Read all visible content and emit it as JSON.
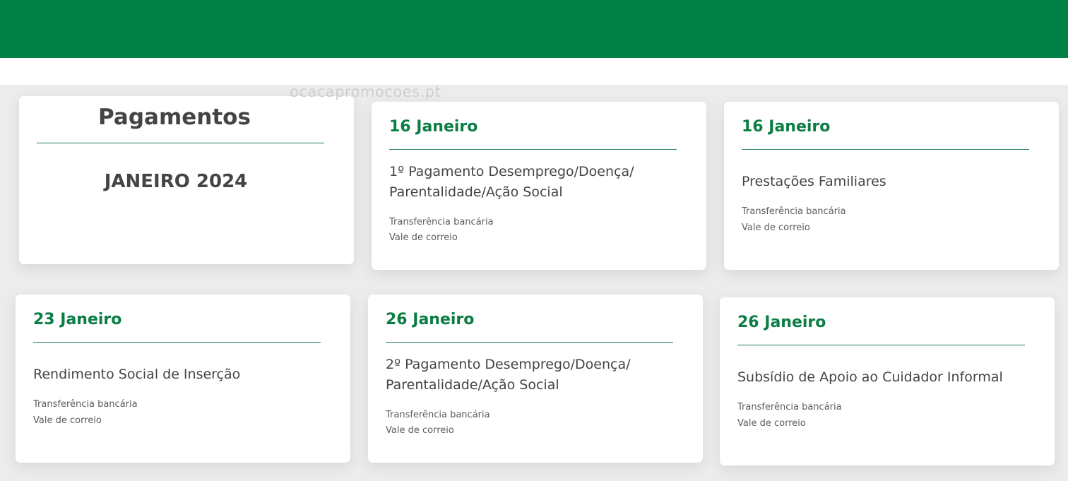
{
  "watermark": "ocacapromocoes.pt",
  "intro": {
    "title": "Pagamentos",
    "month": "JANEIRO 2024"
  },
  "payments": [
    {
      "date": "16 Janeiro",
      "description": "1º Pagamento Desemprego/Doença/ Parentalidade/Ação Social",
      "methods": [
        "Transferência bancária",
        "Vale de correio"
      ]
    },
    {
      "date": "16 Janeiro",
      "description": "Prestações Familiares",
      "methods": [
        "Transferência bancária",
        "Vale de correio"
      ]
    },
    {
      "date": "23 Janeiro",
      "description": "Rendimento Social de Inserção",
      "methods": [
        "Transferência bancária",
        "Vale de correio"
      ]
    },
    {
      "date": "26 Janeiro",
      "description": "2º Pagamento Desemprego/Doença/ Parentalidade/Ação Social",
      "methods": [
        "Transferência bancária",
        "Vale de correio"
      ]
    },
    {
      "date": "26 Janeiro",
      "description": "Subsídio de Apoio ao Cuidador Informal",
      "methods": [
        "Transferência bancária",
        "Vale de correio"
      ]
    }
  ],
  "colors": {
    "brand_green": "#008046",
    "date_green": "#0b7d45",
    "text_dark": "#444444"
  }
}
